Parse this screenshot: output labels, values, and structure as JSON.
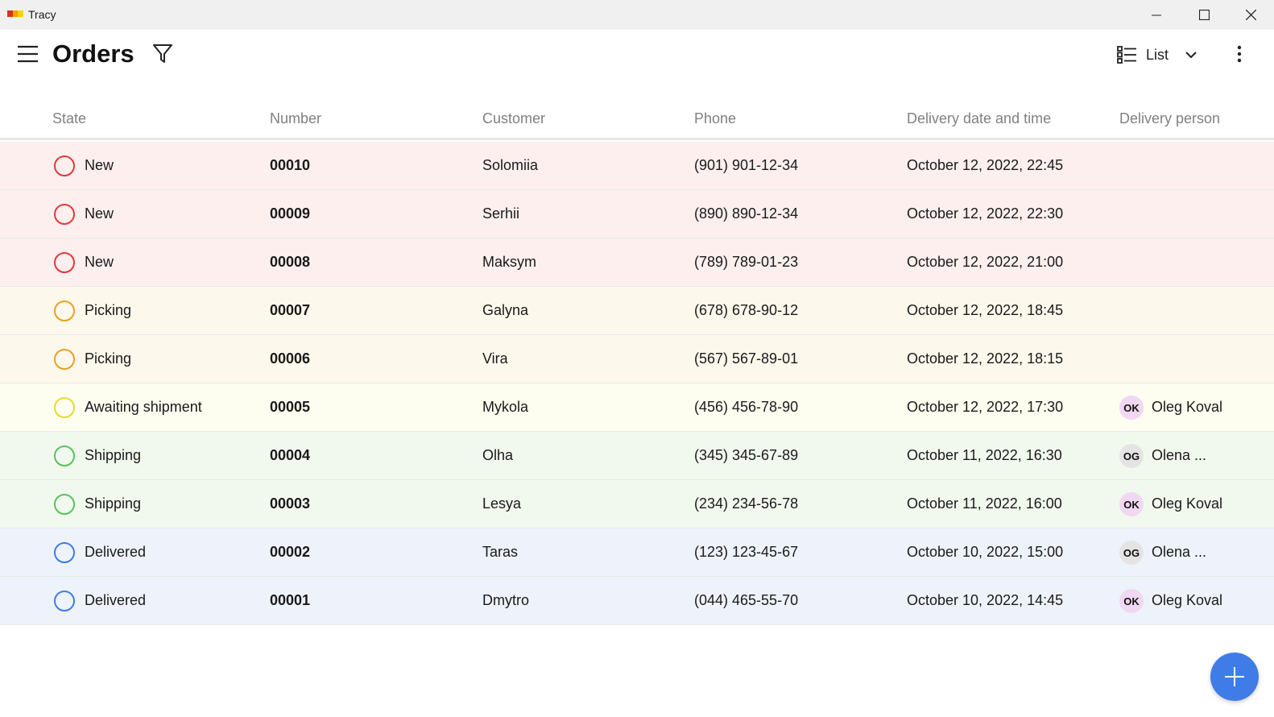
{
  "window": {
    "title": "Tracy",
    "logo_colors": [
      "#d93025",
      "#f4a100",
      "#f7d300"
    ]
  },
  "appbar": {
    "title": "Orders",
    "view_mode": "List"
  },
  "table": {
    "headers": {
      "state": "State",
      "number": "Number",
      "customer": "Customer",
      "phone": "Phone",
      "delivery": "Delivery date and time",
      "person": "Delivery person"
    },
    "rows": [
      {
        "state": "New",
        "ring": "#e0393e",
        "bg": "#fcefee",
        "number": "00010",
        "customer": "Solomiia",
        "phone": "(901) 901-12-34",
        "delivery": "October 12, 2022, 22:45",
        "initials": "",
        "avatar_bg": "",
        "person": ""
      },
      {
        "state": "New",
        "ring": "#e0393e",
        "bg": "#fcefee",
        "number": "00009",
        "customer": "Serhii",
        "phone": "(890) 890-12-34",
        "delivery": "October 12, 2022, 22:30",
        "initials": "",
        "avatar_bg": "",
        "person": ""
      },
      {
        "state": "New",
        "ring": "#e0393e",
        "bg": "#fcefee",
        "number": "00008",
        "customer": "Maksym",
        "phone": "(789) 789-01-23",
        "delivery": "October 12, 2022, 21:00",
        "initials": "",
        "avatar_bg": "",
        "person": ""
      },
      {
        "state": "Picking",
        "ring": "#e8a31c",
        "bg": "#fdf8ec",
        "number": "00007",
        "customer": "Galyna",
        "phone": "(678) 678-90-12",
        "delivery": "October 12, 2022, 18:45",
        "initials": "",
        "avatar_bg": "",
        "person": ""
      },
      {
        "state": "Picking",
        "ring": "#e8a31c",
        "bg": "#fdf8ec",
        "number": "00006",
        "customer": "Vira",
        "phone": "(567) 567-89-01",
        "delivery": "October 12, 2022, 18:15",
        "initials": "",
        "avatar_bg": "",
        "person": ""
      },
      {
        "state": "Awaiting shipment",
        "ring": "#e6dc2e",
        "bg": "#fdfdf0",
        "number": "00005",
        "customer": "Mykola",
        "phone": "(456) 456-78-90",
        "delivery": "October 12, 2022, 17:30",
        "initials": "OK",
        "avatar_bg": "#f1d7f2",
        "person": "Oleg Koval"
      },
      {
        "state": "Shipping",
        "ring": "#5cc05c",
        "bg": "#f1f9ef",
        "number": "00004",
        "customer": "Olha",
        "phone": "(345) 345-67-89",
        "delivery": "October 11, 2022, 16:30",
        "initials": "OG",
        "avatar_bg": "#e4e4e4",
        "person": "Olena ..."
      },
      {
        "state": "Shipping",
        "ring": "#5cc05c",
        "bg": "#f1f9ef",
        "number": "00003",
        "customer": "Lesya",
        "phone": "(234) 234-56-78",
        "delivery": "October 11, 2022, 16:00",
        "initials": "OK",
        "avatar_bg": "#f1d7f2",
        "person": "Oleg Koval"
      },
      {
        "state": "Delivered",
        "ring": "#3f7ce8",
        "bg": "#eef3fb",
        "number": "00002",
        "customer": "Taras",
        "phone": "(123) 123-45-67",
        "delivery": "October 10, 2022, 15:00",
        "initials": "OG",
        "avatar_bg": "#e4e4e4",
        "person": "Olena ..."
      },
      {
        "state": "Delivered",
        "ring": "#3f7ce8",
        "bg": "#eef3fb",
        "number": "00001",
        "customer": "Dmytro",
        "phone": "(044) 465-55-70",
        "delivery": "October 10, 2022, 14:45",
        "initials": "OK",
        "avatar_bg": "#f1d7f2",
        "person": "Oleg Koval"
      }
    ]
  },
  "colors": {
    "accent": "#3f7ce8"
  },
  "icons": {
    "menu": "hamburger-menu-icon",
    "filter": "filter-icon",
    "view": "list-view-icon",
    "dropdown": "chevron-down-icon",
    "more": "more-vertical-icon",
    "add": "plus-icon"
  }
}
